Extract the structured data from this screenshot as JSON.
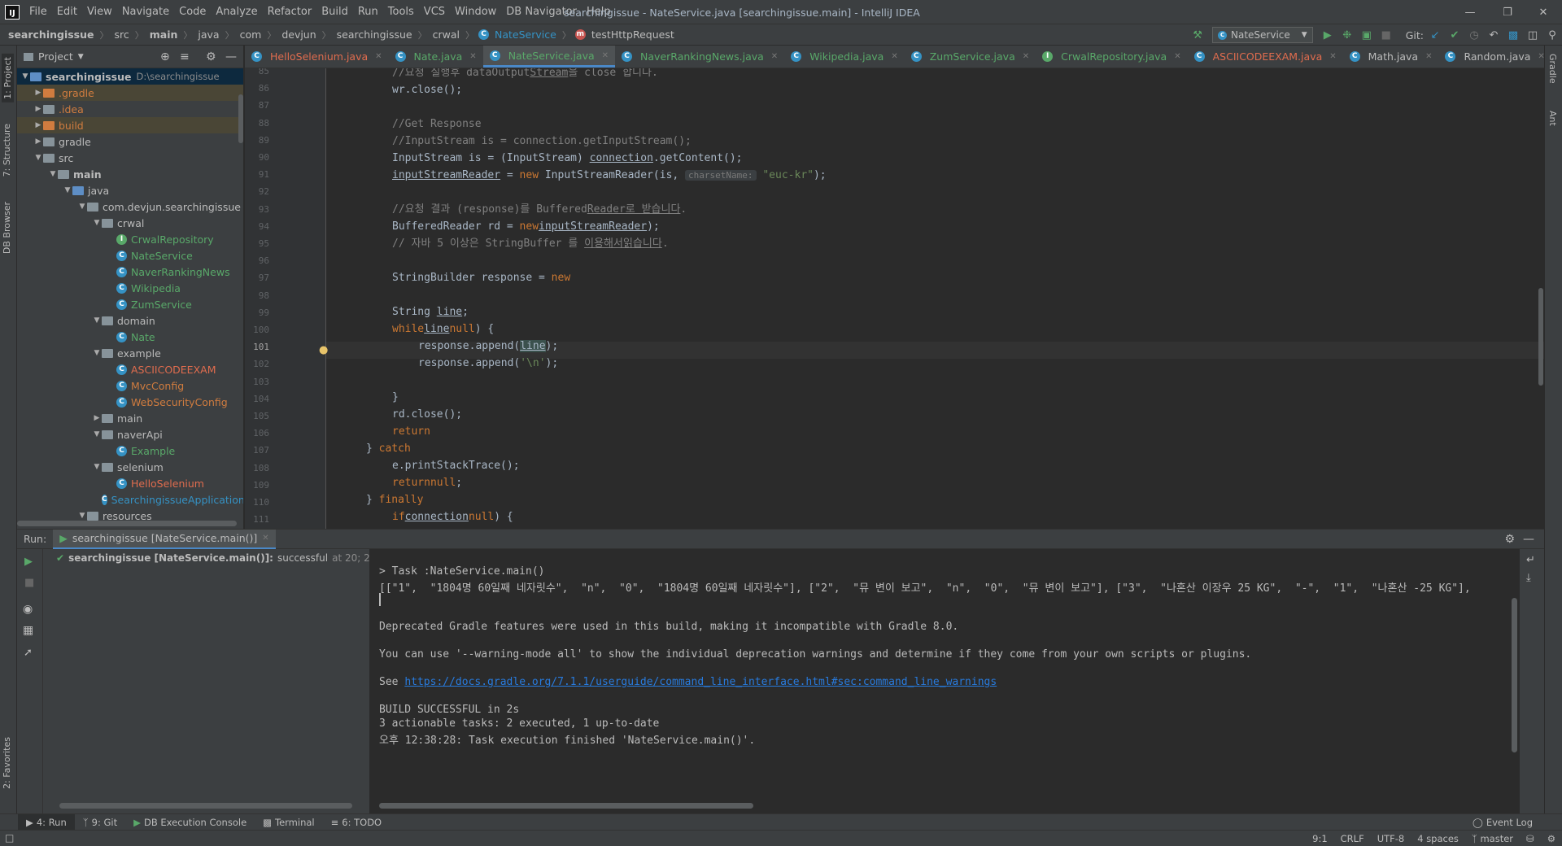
{
  "menu": [
    "File",
    "Edit",
    "View",
    "Navigate",
    "Code",
    "Analyze",
    "Refactor",
    "Build",
    "Run",
    "Tools",
    "VCS",
    "Window",
    "DB Navigator",
    "Help"
  ],
  "window_title": "searchingissue - NateService.java [searchingissue.main] - IntelliJ IDEA",
  "breadcrumbs": [
    "searchingissue",
    "src",
    "main",
    "java",
    "com",
    "devjun",
    "searchingissue",
    "crwal",
    "NateService",
    "testHttpRequest"
  ],
  "run_config": "NateService",
  "git_label": "Git:",
  "project_panel": {
    "title": "Project",
    "root_name": "searchingissue",
    "root_path": "D:\\searchingissue",
    "items": [
      ".gradle",
      ".idea",
      "build",
      "gradle",
      "src",
      "main",
      "java",
      "com.devjun.searchingissue",
      "crwal",
      "CrwalRepository",
      "NateService",
      "NaverRankingNews",
      "Wikipedia",
      "ZumService",
      "domain",
      "Nate",
      "example",
      "ASCIICODEEXAM",
      "MvcConfig",
      "WebSecurityConfig",
      "main",
      "naverApi",
      "Example",
      "selenium",
      "HelloSelenium",
      "SearchingissueApplication",
      "resources"
    ]
  },
  "tabs": [
    "HelloSelenium.java",
    "Nate.java",
    "NateService.java",
    "NaverRankingNews.java",
    "Wikipedia.java",
    "ZumService.java",
    "CrwalRepository.java",
    "ASCIICODEEXAM.java",
    "Math.java",
    "Random.java"
  ],
  "side_labels": {
    "project": "1: Project",
    "structure": "7: Structure",
    "dbbrowser": "DB Browser",
    "favorites": "2: Favorites",
    "gradle": "Gradle",
    "ant": "Ant"
  },
  "editor": {
    "line_numbers": [
      "85",
      "86",
      "87",
      "88",
      "89",
      "90",
      "91",
      "92",
      "93",
      "94",
      "95",
      "96",
      "97",
      "98",
      "99",
      "100",
      "101",
      "102",
      "103",
      "104",
      "105",
      "106",
      "107",
      "108",
      "109",
      "110",
      "111"
    ],
    "lines": {
      "l85a": "//요청 실행후 dataOutput",
      "l85b": "Stream",
      "l85c": "을 close 합니다.",
      "l86": "wr.close();",
      "l88": "//Get Response",
      "l89": "//InputStream is = connection.getInputStream();",
      "l90a": "InputStream is = (InputStream) ",
      "l90b": "connection",
      ".l90c": "",
      "l90d": ".getContent();",
      "l91a": "inputStreamReader",
      "l91b": " = ",
      "l91c": "new",
      " l91d": "",
      "l91e": " InputStreamReader(is, ",
      "l91hint": "charsetName:",
      "l91str": "\"euc-kr\"",
      "l91end": ");",
      "l93a": "//요청 결과 (response)를 Buffered",
      "l93b": "Reader로 받습니다",
      "l93c": ".",
      "l94a": "BufferedReader rd = ",
      "l94b": "new",
      " l94c": "",
      " l94d": " BufferedReader(",
      "l94e": "inputStreamReader",
      "l94f": ");",
      "l95a": "// 자바 5 이상은 StringBuffer 를 ",
      "l95b": "이용해서",
      " l95c": "",
      " l95d": " 결과 값을 ",
      "l95e": "읽습니다",
      ".l95f": "",
      "l97a": "StringBuilder response = ",
      "l97b": "new",
      " l97c": "",
      " l97d": " StringBuilder();",
      "l99a": "String ",
      "l99b": "line",
      ".l99c": "",
      "l100a": "while",
      " l100b": "",
      " l100c": " ((",
      "l100d": "line",
      " l100e": "",
      " l100f": " = rd.readLine()) != ",
      "l100g": "null",
      ") l100h": "",
      "l101a": "response.append(",
      "l101b": "line",
      "l101c": ");",
      "l102a": "response.append(",
      "l102b": "'\\n'",
      "l102c": ");",
      "l104": "}",
      "l105": "rd.close();",
      "l106a": "return",
      " l106b": "",
      " l106c": " response.toString();",
      "l107a": "} ",
      "l107b": "catch",
      " l107c": "",
      " l107d": " (Exception e) {",
      "l108": "e.printStackTrace();",
      "l109a": "return",
      " l109b": "",
      " l109c": " ",
      "l109d": "null",
      ";": "",
      "l110a": "} ",
      "l110b": "finally",
      " l110c": "",
      " l110d": " {",
      "l111a": "if",
      " l111b": "",
      " l111c": " (",
      "l111d": "connection",
      " l111e": "",
      " l111f": " != ",
      "l111g": "null",
      ") {": ""
    }
  },
  "run": {
    "label": "Run:",
    "tab": "searchingissue [NateService.main()]",
    "tree_item": "searchingissue [NateService.main()]:",
    "tree_status": "successful",
    "tree_time": "at 20; 2 s 327 ms",
    "console": [
      "> Task :NateService.main()",
      "[[\"1\",  \"1804명 60일째 네자릿수\",  \"n\",  \"0\",  \"1804명 60일째 네자릿수\"], [\"2\",  \"뮤 변이 보고\",  \"n\",  \"0\",  \"뮤 변이 보고\"], [\"3\",  \"나혼산 이장우 25 KG\",  \"-\",  \"1\",  \"나혼산 -25 KG\"],",
      "",
      "",
      "Deprecated Gradle features were used in this build, making it incompatible with Gradle 8.0.",
      "",
      "You can use '--warning-mode all' to show the individual deprecation warnings and determine if they come from your own scripts or plugins.",
      "",
      "See ",
      "",
      "BUILD SUCCESSFUL in 2s",
      "3 actionable tasks: 2 executed, 1 up-to-date",
      "오후 12:38:28: Task execution finished 'NateService.main()'."
    ],
    "link": "https://docs.gradle.org/7.1.1/userguide/command_line_interface.html#sec:command_line_warnings"
  },
  "bottom_tools": [
    "4: Run",
    "9: Git",
    "DB Execution Console",
    "Terminal",
    "6: TODO"
  ],
  "event_log": "Event Log",
  "status": {
    "position": "9:1",
    "line_sep": "CRLF",
    "encoding": "UTF-8",
    "indent": "4 spaces",
    "branch": "master"
  }
}
